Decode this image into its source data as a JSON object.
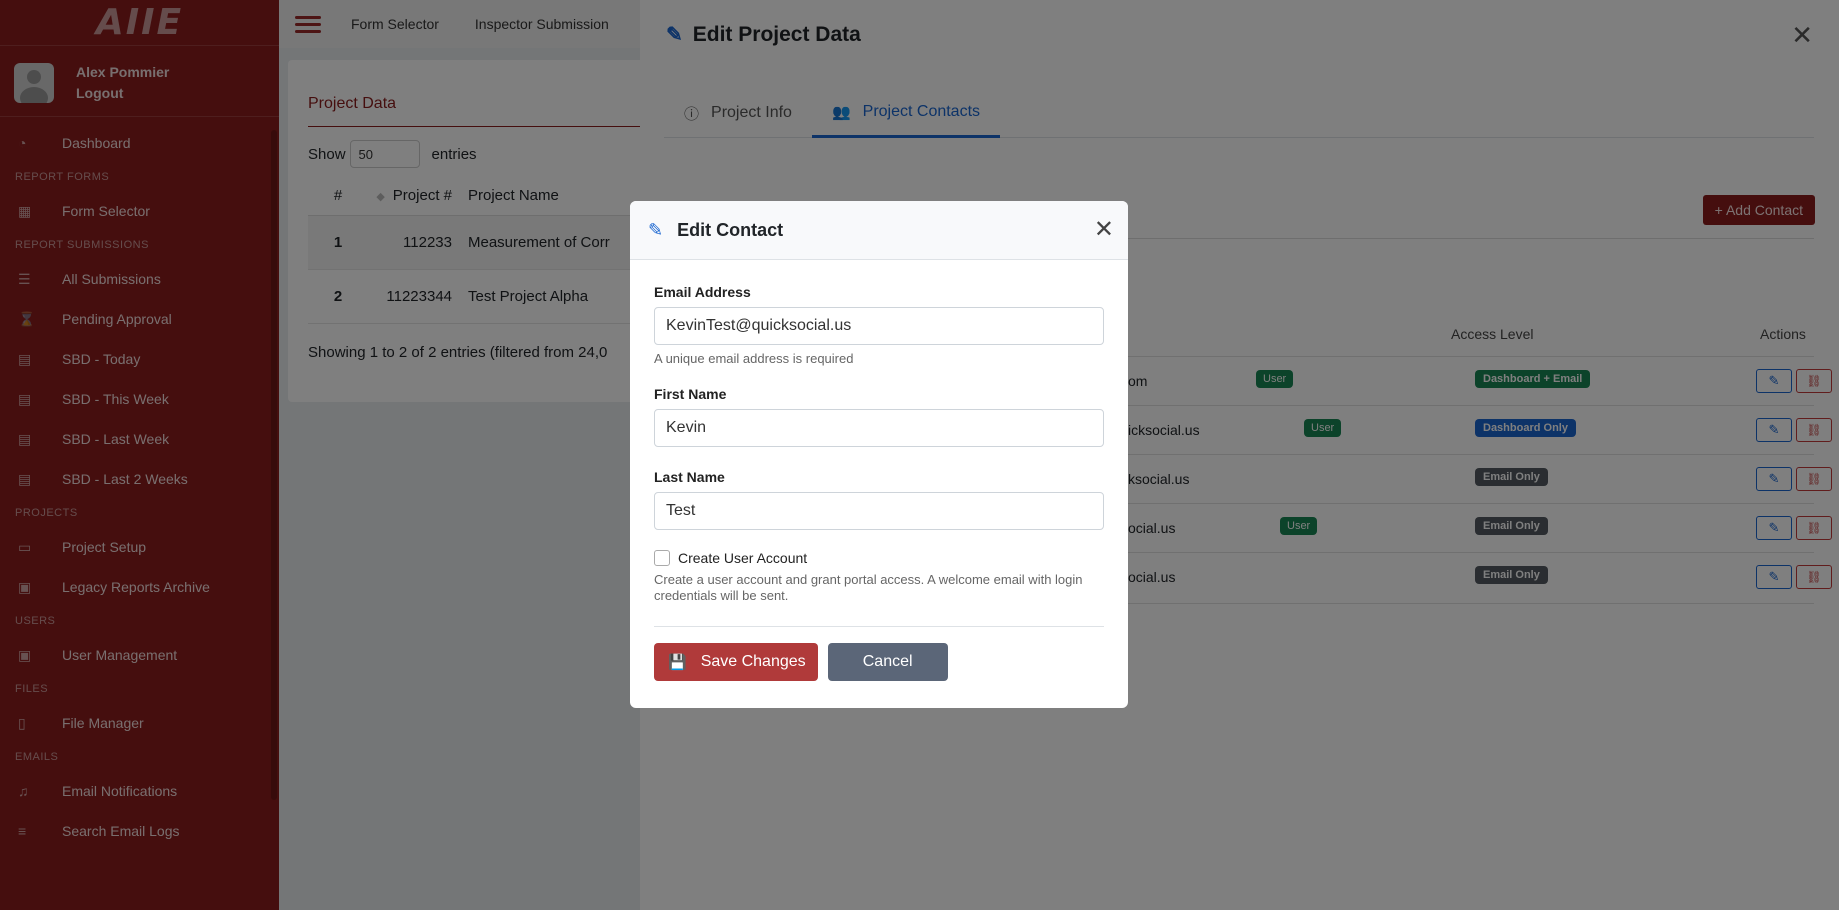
{
  "brand": {
    "logo_text": "AIIE"
  },
  "user": {
    "name": "Alex Pommier",
    "logout_label": "Logout"
  },
  "sidebar": {
    "items": [
      {
        "type": "item",
        "label": "Dashboard",
        "icon": "dashboard-icon",
        "glyph": "◔"
      },
      {
        "type": "section",
        "label": "REPORT FORMS"
      },
      {
        "type": "item",
        "label": "Form Selector",
        "icon": "grid-icon",
        "glyph": "▦"
      },
      {
        "type": "section",
        "label": "REPORT SUBMISSIONS"
      },
      {
        "type": "item",
        "label": "All Submissions",
        "icon": "list-icon",
        "glyph": "☰"
      },
      {
        "type": "item",
        "label": "Pending Approval",
        "icon": "hourglass-icon",
        "glyph": "⌛"
      },
      {
        "type": "item",
        "label": "SBD - Today",
        "icon": "calendar-icon",
        "glyph": "▤"
      },
      {
        "type": "item",
        "label": "SBD - This Week",
        "icon": "calendar-icon",
        "glyph": "▤"
      },
      {
        "type": "item",
        "label": "SBD - Last Week",
        "icon": "calendar-icon",
        "glyph": "▤"
      },
      {
        "type": "item",
        "label": "SBD - Last 2 Weeks",
        "icon": "calendar-icon",
        "glyph": "▤"
      },
      {
        "type": "section",
        "label": "PROJECTS"
      },
      {
        "type": "item",
        "label": "Project Setup",
        "icon": "folder-icon",
        "glyph": "▭"
      },
      {
        "type": "item",
        "label": "Legacy Reports Archive",
        "icon": "archive-icon",
        "glyph": "▣"
      },
      {
        "type": "section",
        "label": "USERS"
      },
      {
        "type": "item",
        "label": "User Management",
        "icon": "user-id-icon",
        "glyph": "▣"
      },
      {
        "type": "section",
        "label": "FILES"
      },
      {
        "type": "item",
        "label": "File Manager",
        "icon": "file-icon",
        "glyph": "▯"
      },
      {
        "type": "section",
        "label": "EMAILS"
      },
      {
        "type": "item",
        "label": "Email Notifications",
        "icon": "bell-icon",
        "glyph": "♫"
      },
      {
        "type": "item",
        "label": "Search Email Logs",
        "icon": "database-icon",
        "glyph": "≡"
      }
    ]
  },
  "topbar": {
    "links": [
      "Form Selector",
      "Inspector Submission"
    ]
  },
  "project_data": {
    "title": "Project Data",
    "show_label": "Show",
    "page_size": "50",
    "entries_label": "entries",
    "columns": [
      "#",
      "Project #",
      "Project Name"
    ],
    "rows": [
      {
        "n": "1",
        "project_no": "112233",
        "name": "Measurement of Corr"
      },
      {
        "n": "2",
        "project_no": "11223344",
        "name": "Test Project Alpha"
      }
    ],
    "footer": "Showing 1 to 2 of 2 entries (filtered from 24,0"
  },
  "panel": {
    "title": "Edit Project Data",
    "tabs": [
      {
        "label": "Project Info",
        "icon": "info-icon",
        "active": false
      },
      {
        "label": "Project Contacts",
        "icon": "users-icon",
        "active": true
      }
    ],
    "add_contact_label": "+ Add Contact",
    "columns": {
      "access": "Access Level",
      "actions": "Actions"
    },
    "contacts": [
      {
        "email": "om",
        "user_badge": "User",
        "access": "Dashboard + Email",
        "access_color": "#198754"
      },
      {
        "email": "icksocial.us",
        "user_badge": "User",
        "access": "Dashboard Only",
        "access_color": "#1a66d1"
      },
      {
        "email": "ksocial.us",
        "user_badge": "",
        "access": "Email Only",
        "access_color": "#555b62"
      },
      {
        "email": "ocial.us",
        "user_badge": "User",
        "access": "Email Only",
        "access_color": "#555b62"
      },
      {
        "email": "ocial.us",
        "user_badge": "",
        "access": "Email Only",
        "access_color": "#555b62"
      }
    ]
  },
  "modal": {
    "title": "Edit Contact",
    "email_label": "Email Address",
    "email_value": "KevinTest@quicksocial.us",
    "email_help": "A unique email address is required",
    "first_label": "First Name",
    "first_value": "Kevin",
    "last_label": "Last Name",
    "last_value": "Test",
    "create_account_label": "Create User Account",
    "create_account_help": "Create a user account and grant portal access. A welcome email with login credentials will be sent.",
    "save_label": "Save Changes",
    "cancel_label": "Cancel"
  },
  "colors": {
    "brand_red": "#8b1c1c",
    "accent_blue": "#1a66d1",
    "save_red": "#b03a3a",
    "cancel_gray": "#5b6678"
  }
}
